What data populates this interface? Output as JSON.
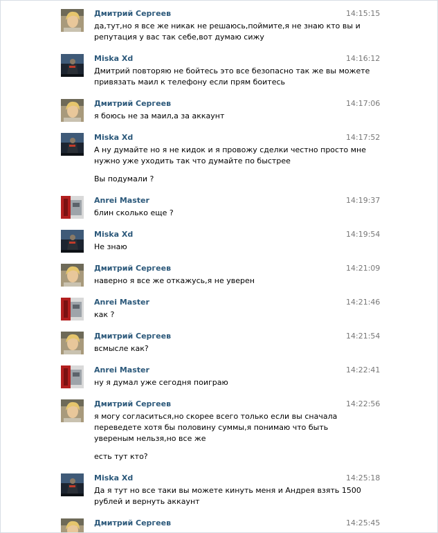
{
  "messages": [
    {
      "author": "Дмитрий Сергеев",
      "avatar": "person-photo-avatar",
      "time": "14:15:15",
      "lines": [
        "да,тут,но я все же никак не решаюсь,поймите,я не знаю кто вы и",
        "репутация у вас так себе,вот думаю сижу"
      ]
    },
    {
      "author": "Miska Xd",
      "avatar": "soldier-poster-avatar",
      "time": "14:16:12",
      "lines": [
        "Дмитрий повторяю не бойтесь это все безопасно так же вы можете",
        "привязать маил к телефону если прям боитесь"
      ]
    },
    {
      "author": "Дмитрий Сергеев",
      "avatar": "person-photo-avatar",
      "time": "14:17:06",
      "lines": [
        "я боюсь не за маил,а за аккаунт"
      ]
    },
    {
      "author": "Miska Xd",
      "avatar": "soldier-poster-avatar",
      "time": "14:17:52",
      "lines": [
        "А ну думайте но я не кидок и я провожу сделки честно просто мне",
        "нужно уже уходить так что думайте по быстрее",
        "Вы подумали ?"
      ]
    },
    {
      "author": "Anrei Master",
      "avatar": "red-robot-avatar",
      "time": "14:19:37",
      "lines": [
        "блин сколько еще ?"
      ]
    },
    {
      "author": "Miska Xd",
      "avatar": "soldier-poster-avatar",
      "time": "14:19:54",
      "lines": [
        "Не знаю"
      ]
    },
    {
      "author": "Дмитрий Сергеев",
      "avatar": "person-photo-avatar",
      "time": "14:21:09",
      "lines": [
        "наверно я все же откажусь,я не уверен"
      ]
    },
    {
      "author": "Anrei Master",
      "avatar": "red-robot-avatar",
      "time": "14:21:46",
      "lines": [
        "как ?"
      ]
    },
    {
      "author": "Дмитрий Сергеев",
      "avatar": "person-photo-avatar",
      "time": "14:21:54",
      "lines": [
        "всмысле как?"
      ]
    },
    {
      "author": "Anrei Master",
      "avatar": "red-robot-avatar",
      "time": "14:22:41",
      "lines": [
        "ну я думал уже сегодня поиграю"
      ]
    },
    {
      "author": "Дмитрий Сергеев",
      "avatar": "person-photo-avatar",
      "time": "14:22:56",
      "lines": [
        "я могу согласиться,но скорее всего только если вы сначала",
        "переведете хотя бы половину суммы,я понимаю что быть",
        "увереным нельзя,но все же",
        "есть тут кто?"
      ]
    },
    {
      "author": "Miska Xd",
      "avatar": "soldier-poster-avatar",
      "time": "14:25:18",
      "lines": [
        "Да я тут но все таки вы можете кинуть меня и Андрея взять 1500",
        "рублей и вернуть аккаунт"
      ]
    },
    {
      "author": "Дмитрий Сергеев",
      "avatar": "person-photo-avatar",
      "time": "14:25:45",
      "lines": []
    }
  ]
}
